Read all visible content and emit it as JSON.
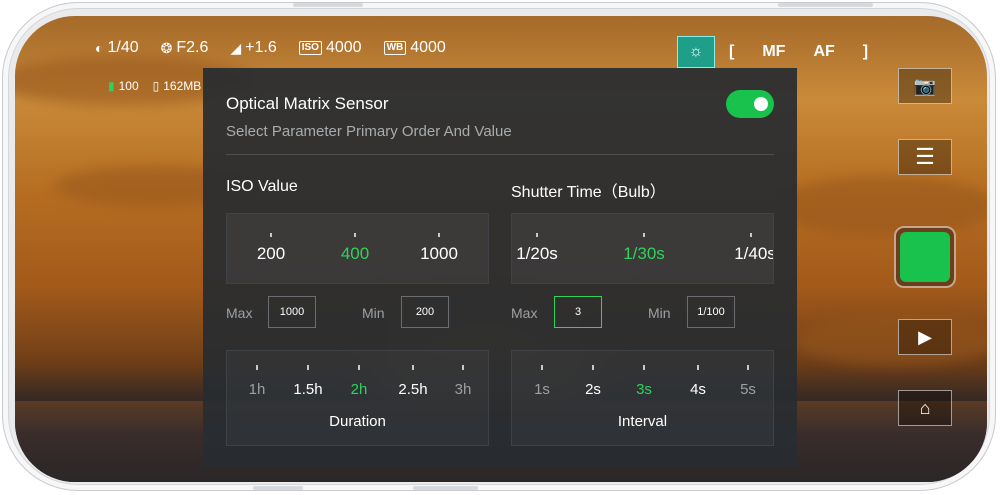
{
  "status": {
    "shutter": "1/40",
    "aperture": "F2.6",
    "exposure": "+1.6",
    "iso_tag": "ISO",
    "iso": "4000",
    "wb_tag": "WB",
    "wb": "4000",
    "battery": "100",
    "storage": "162MB",
    "focus_open": "[",
    "focus_mf": "MF",
    "focus_af": "AF",
    "focus_close": "]"
  },
  "panel": {
    "title": "Optical Matrix Sensor",
    "subtitle": "Select Parameter Primary Order And Value",
    "toggle_on": true,
    "iso_section": "ISO Value",
    "shutter_section": "Shutter Time（Bulb）",
    "iso_options": [
      "200",
      "400",
      "1000"
    ],
    "iso_selected": 1,
    "shutter_options": [
      "1/20s",
      "1/30s",
      "1/40s"
    ],
    "shutter_selected": 1,
    "iso_max_label": "Max",
    "iso_max": "1000",
    "iso_min_label": "Min",
    "iso_min": "200",
    "shutter_max_label": "Max",
    "shutter_max": "3",
    "shutter_min_label": "Min",
    "shutter_min": "1/100",
    "duration_options": [
      "1h",
      "1.5h",
      "2h",
      "2.5h",
      "3h"
    ],
    "duration_selected": 2,
    "duration_caption": "Duration",
    "interval_options": [
      "1s",
      "2s",
      "3s",
      "4s",
      "5s"
    ],
    "interval_selected": 2,
    "interval_caption": "Interval"
  },
  "colors": {
    "accent": "#18c24c",
    "panel": "#2c3034"
  },
  "icons": [
    "shutter-speed-icon",
    "aperture-icon",
    "exposure-icon",
    "battery-icon",
    "sd-card-icon",
    "eye-icon",
    "lock-icon",
    "mode-icon",
    "camera-switch-icon",
    "menu-icon",
    "play-icon",
    "home-icon"
  ]
}
